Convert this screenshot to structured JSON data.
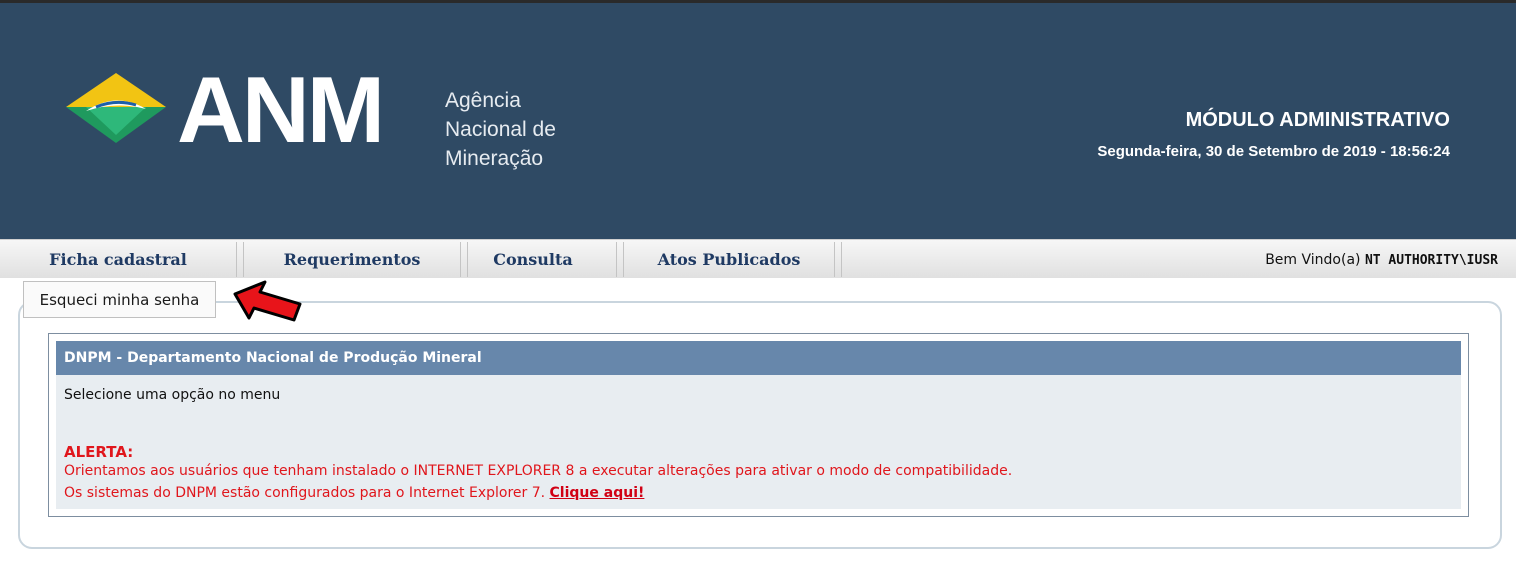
{
  "header": {
    "brand": "ANM",
    "agency_lines": [
      "Agência",
      "Nacional de",
      "Mineração"
    ],
    "module_title": "MÓDULO ADMINISTRATIVO",
    "datetime": "Segunda-feira, 30 de Setembro de 2019 - 18:56:24"
  },
  "menu": {
    "items": [
      {
        "label": "Ficha cadastral"
      },
      {
        "label": "Requerimentos"
      },
      {
        "label": "Consulta"
      },
      {
        "label": "Atos Publicados"
      }
    ],
    "welcome_prefix": "Bem Vindo(a)",
    "welcome_user": "NT AUTHORITY\\IUSR"
  },
  "submenu": {
    "forgot_password": "Esqueci minha senha"
  },
  "panel": {
    "title": "DNPM - Departamento Nacional de Produção Mineral",
    "instruction": "Selecione uma opção no menu",
    "alert_title": "ALERTA:",
    "alert_line1": "Orientamos aos usuários que tenham instalado o INTERNET EXPLORER 8 a executar alterações para ativar o modo de compatibilidade.",
    "alert_line2": "Os sistemas do DNPM estão configurados para o Internet Explorer 7.",
    "alert_link": "Clique aqui!"
  },
  "colors": {
    "header_bg": "#2f4a64",
    "panel_head_bg": "#6787ab",
    "alert_red": "#e0161c",
    "menu_text": "#1f3a63"
  },
  "icons": {
    "logo": "anm-diamond-logo-icon",
    "pointer": "red-arrow-pointer-icon"
  }
}
